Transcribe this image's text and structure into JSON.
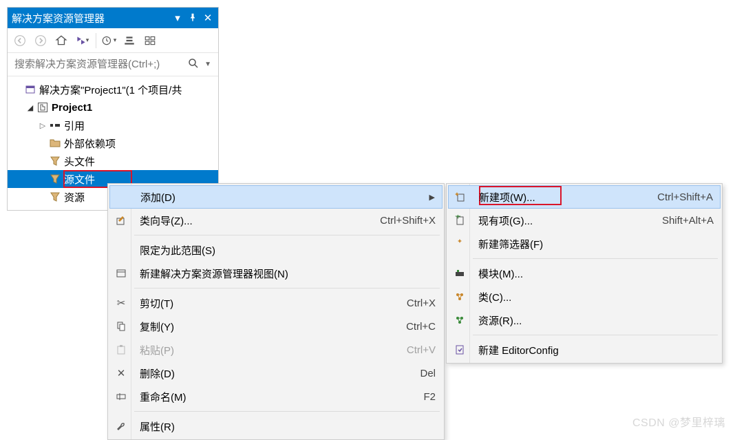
{
  "titlebar": {
    "title": "解决方案资源管理器"
  },
  "search": {
    "placeholder": "搜索解决方案资源管理器(Ctrl+;)"
  },
  "tree": {
    "solution": "解决方案\"Project1\"(1 个项目/共",
    "project": "Project1",
    "references": "引用",
    "external_deps": "外部依赖项",
    "headers": "头文件",
    "sources": "源文件",
    "resources": "资源"
  },
  "menu1": {
    "add": "添加(D)",
    "class_wizard": "类向导(Z)...",
    "class_wizard_shortcut": "Ctrl+Shift+X",
    "scope": "限定为此范围(S)",
    "new_view": "新建解决方案资源管理器视图(N)",
    "cut": "剪切(T)",
    "cut_shortcut": "Ctrl+X",
    "copy": "复制(Y)",
    "copy_shortcut": "Ctrl+C",
    "paste": "粘贴(P)",
    "paste_shortcut": "Ctrl+V",
    "delete": "删除(D)",
    "delete_shortcut": "Del",
    "rename": "重命名(M)",
    "rename_shortcut": "F2",
    "properties": "属性(R)"
  },
  "menu2": {
    "new_item": "新建项(W)...",
    "new_item_shortcut": "Ctrl+Shift+A",
    "existing_item": "现有项(G)...",
    "existing_item_shortcut": "Shift+Alt+A",
    "new_filter": "新建筛选器(F)",
    "module": "模块(M)...",
    "class": "类(C)...",
    "resource": "资源(R)...",
    "editorconfig": "新建 EditorConfig"
  },
  "watermark": "CSDN @梦里梓璃"
}
